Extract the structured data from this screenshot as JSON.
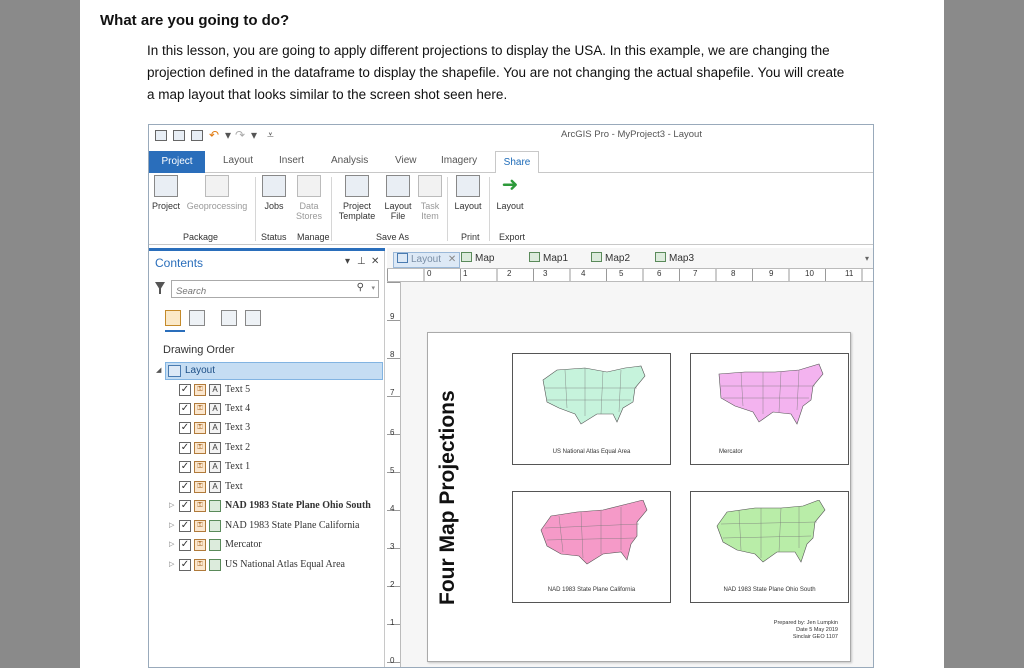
{
  "document": {
    "heading": "What are you going to do?",
    "paragraph": "In this lesson, you are going to apply different projections to display the USA.  In this example, we are changing the projection defined in the dataframe to display the shapefile.  You are not changing the actual shapefile.  You will create a map layout that looks similar to the screen shot seen here."
  },
  "app": {
    "title": "ArcGIS Pro - MyProject3 - Layout",
    "tabs": [
      "Project",
      "Layout",
      "Insert",
      "Analysis",
      "View",
      "Imagery",
      "Share"
    ],
    "active_tab": "Share",
    "ribbon": {
      "buttons": [
        {
          "label": "Project",
          "dim": false
        },
        {
          "label": "Geoprocessing",
          "dim": true
        },
        {
          "label": "Jobs",
          "dim": false
        },
        {
          "label": "Data Stores",
          "dim": true
        },
        {
          "label": "Project Template",
          "dim": false
        },
        {
          "label": "Layout File",
          "dim": false
        },
        {
          "label": "Task Item",
          "dim": true
        },
        {
          "label": "Layout",
          "dim": false
        },
        {
          "label": "Layout",
          "dim": false
        }
      ],
      "groups": [
        "Package",
        "Status",
        "Manage",
        "Save As",
        "Print",
        "Export"
      ]
    },
    "contents": {
      "title": "Contents",
      "search_placeholder": "Search",
      "drawing_order_label": "Drawing Order",
      "root_item": "Layout",
      "items": [
        {
          "label": "Text 5",
          "type": "text",
          "bold": false
        },
        {
          "label": "Text 4",
          "type": "text",
          "bold": false
        },
        {
          "label": "Text 3",
          "type": "text",
          "bold": false
        },
        {
          "label": "Text 2",
          "type": "text",
          "bold": false
        },
        {
          "label": "Text 1",
          "type": "text",
          "bold": false
        },
        {
          "label": "Text",
          "type": "text",
          "bold": false
        },
        {
          "label": "NAD 1983 State Plane Ohio South",
          "type": "map",
          "bold": true
        },
        {
          "label": "NAD 1983 State Plane California",
          "type": "map",
          "bold": false
        },
        {
          "label": "Mercator",
          "type": "map",
          "bold": false
        },
        {
          "label": "US National Atlas Equal Area",
          "type": "map",
          "bold": false
        }
      ]
    },
    "view": {
      "doc_tabs": [
        "Layout",
        "Map",
        "Map1",
        "Map2",
        "Map3"
      ],
      "active_doc_tab": "Layout",
      "ruler_h": [
        "0",
        "1",
        "2",
        "3",
        "4",
        "5",
        "6",
        "7",
        "8",
        "9",
        "10",
        "11"
      ],
      "ruler_v": [
        "9",
        "8",
        "7",
        "6",
        "5",
        "4",
        "3",
        "2",
        "1",
        "0"
      ]
    },
    "layout": {
      "title": "Four Map Projections",
      "maps": [
        {
          "caption": "US National Atlas Equal Area",
          "color": "#c6f3dc"
        },
        {
          "caption": "Mercator",
          "color": "#f3b3ef"
        },
        {
          "caption": "NAD 1983 State Plane California",
          "color": "#f59ac8"
        },
        {
          "caption": "NAD 1983 State Plane Ohio South",
          "color": "#b9eda8"
        }
      ],
      "credits": [
        "Prepared by: Jen Lumpkin",
        "Date 5 May 2019",
        "Sinclair GEO 1107"
      ]
    }
  }
}
